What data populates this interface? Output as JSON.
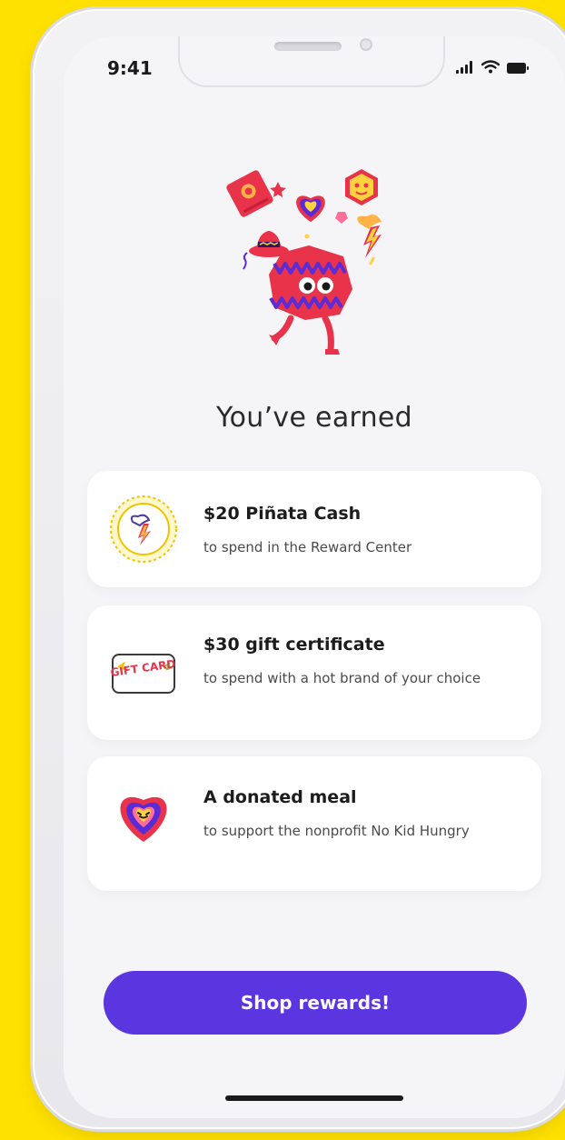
{
  "status_bar": {
    "time": "9:41",
    "icons": [
      "signal-icon",
      "wifi-icon",
      "battery-icon"
    ]
  },
  "headline": "You’ve earned",
  "rewards": [
    {
      "icon": "pinata-cash-coin-icon",
      "title": "$20 Piñata Cash",
      "subtitle": "to spend in the Reward Center"
    },
    {
      "icon": "gift-card-icon",
      "icon_text": "GIFT CARD",
      "title": "$30 gift certificate",
      "subtitle": "to spend with a hot brand of your choice"
    },
    {
      "icon": "heart-icon",
      "title": "A donated meal",
      "subtitle": "to support the nonprofit No Kid Hungry"
    }
  ],
  "cta": {
    "label": "Shop rewards!"
  },
  "colors": {
    "background": "#FFE100",
    "accent": "#5A35E0",
    "card": "#FFFFFF",
    "screen": "#F5F5F7"
  }
}
